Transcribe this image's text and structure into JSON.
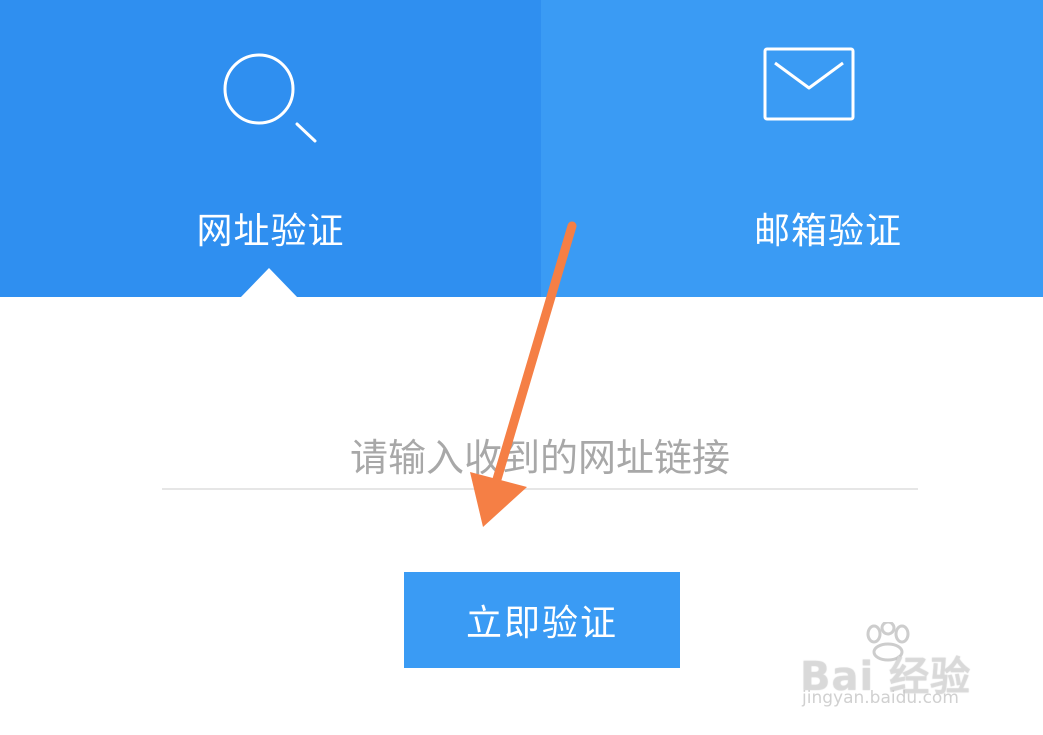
{
  "tabs": [
    {
      "label": "网址验证",
      "icon": "search-icon",
      "active": true
    },
    {
      "label": "邮箱验证",
      "icon": "envelope-icon",
      "active": false
    }
  ],
  "input": {
    "placeholder": "请输入收到的网址链接",
    "value": ""
  },
  "button": {
    "label": "立即验证"
  },
  "watermark": {
    "brand": "Bai 经验",
    "url": "jingyan.baidu.com"
  },
  "colors": {
    "active_tab": "#2f8ff0",
    "inactive_tab": "#3a9bf4",
    "button": "#3a9bf4",
    "annotation_arrow": "#f57f45"
  }
}
